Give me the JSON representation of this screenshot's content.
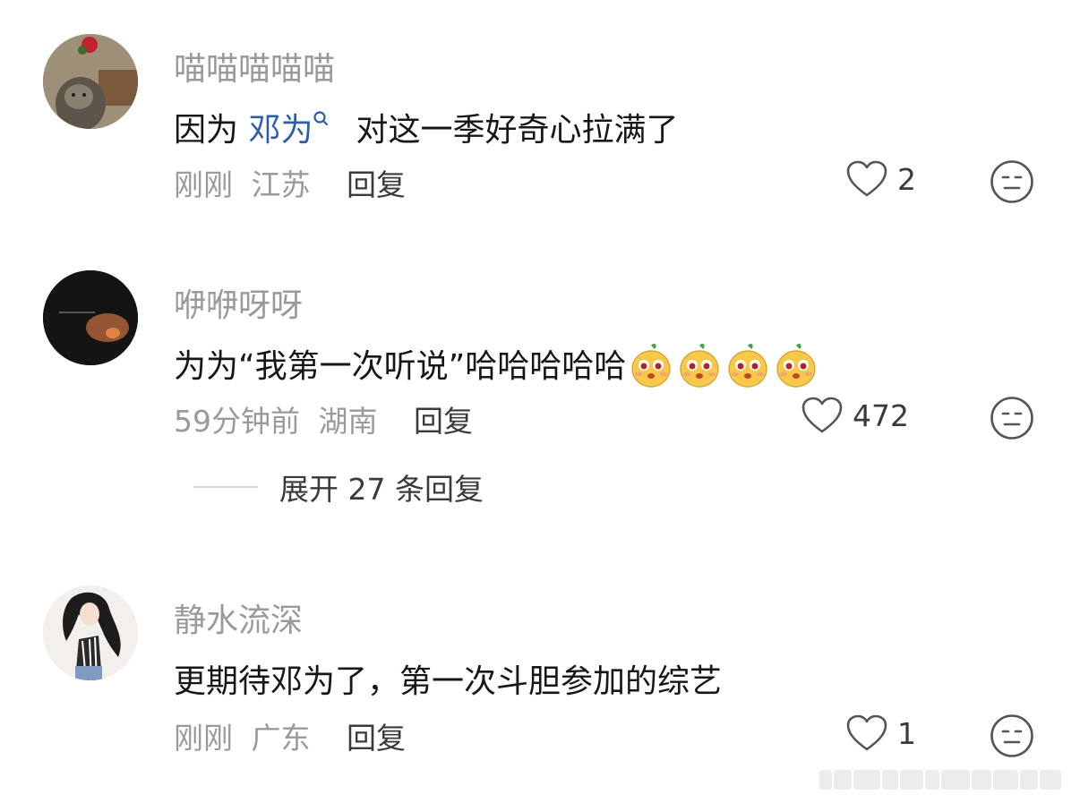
{
  "comments": [
    {
      "username": "喵喵喵喵喵",
      "text_before": "因为 ",
      "mention": "邓为",
      "text_after": "对这一季好奇心拉满了",
      "time": "刚刚",
      "location": "江苏",
      "reply_label": "回复",
      "likes": "2"
    },
    {
      "username": "咿咿呀呀",
      "text": "为为“我第一次听说”哈哈哈哈哈",
      "time": "59分钟前",
      "location": "湖南",
      "reply_label": "回复",
      "likes": "472",
      "expand_label": "展开 27 条回复"
    },
    {
      "username": "静水流深",
      "text": "更期待邓为了，第一次斗胆参加的综艺",
      "time": "刚刚",
      "location": "广东",
      "reply_label": "回复",
      "likes": "1"
    }
  ],
  "icons": {
    "like": "heart-outline-icon",
    "dislike": "neutral-face-icon",
    "mention": "search-icon",
    "emoji": "cute-yellow-face-emoji"
  },
  "colors": {
    "username": "#9a9a9a",
    "mention": "#2f5ea8",
    "text": "#171717",
    "meta": "#9a9a9a"
  }
}
